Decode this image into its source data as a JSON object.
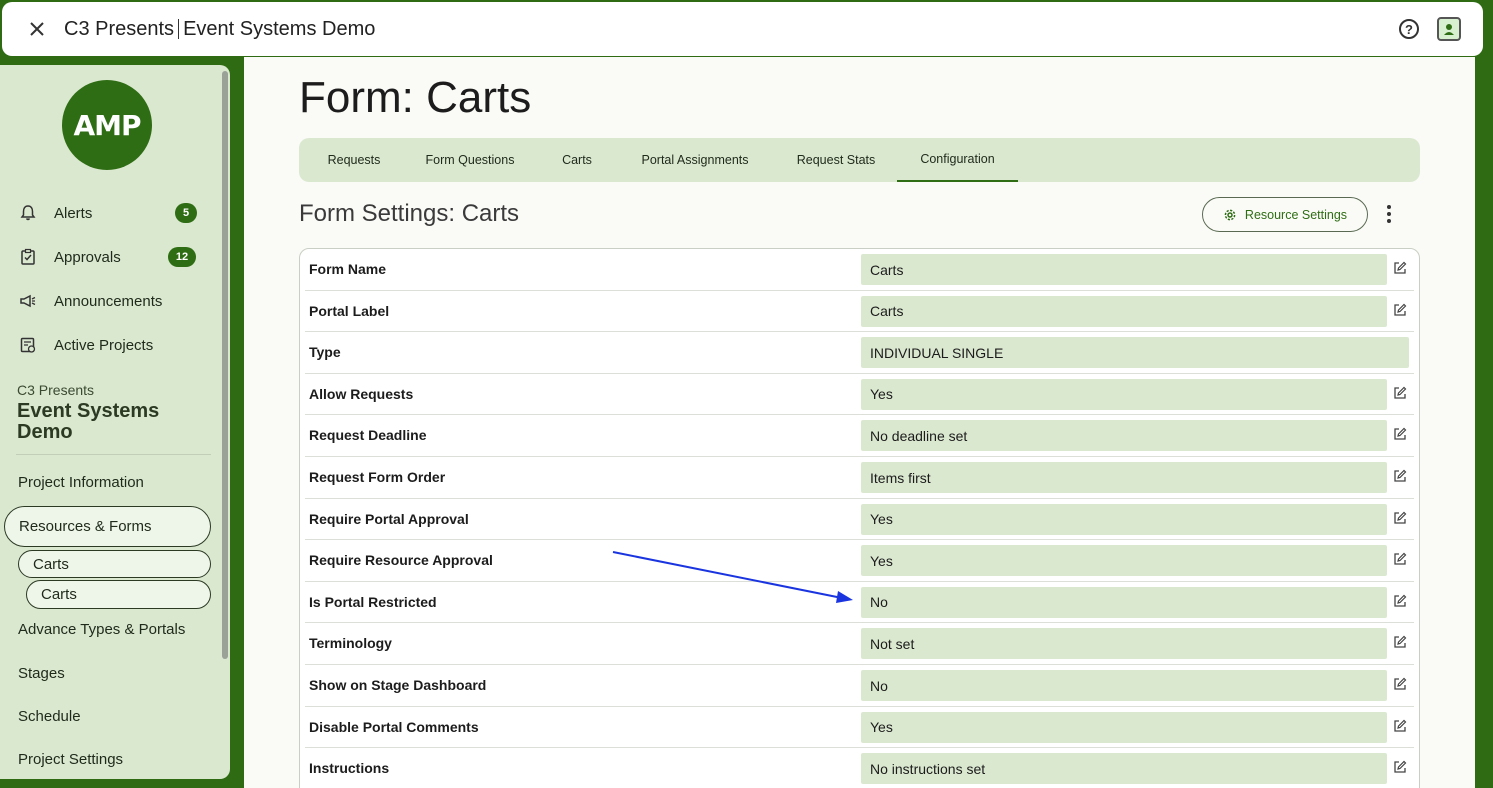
{
  "topbar": {
    "org": "C3 Presents",
    "project": "Event Systems Demo"
  },
  "sidebar": {
    "logo_text": "AMP",
    "nav": [
      {
        "label": "Alerts",
        "badge": "5",
        "icon": "bell-icon"
      },
      {
        "label": "Approvals",
        "badge": "12",
        "icon": "clipboard-check-icon"
      },
      {
        "label": "Announcements",
        "icon": "megaphone-icon"
      },
      {
        "label": "Active Projects",
        "icon": "project-list-icon"
      }
    ],
    "project_org": "C3 Presents",
    "project_name": "Event Systems Demo",
    "menu": {
      "project_information": "Project Information",
      "resources_forms": "Resources & Forms",
      "carts_1": "Carts",
      "carts_2": "Carts",
      "advance_types": "Advance Types & Portals",
      "stages": "Stages",
      "schedule": "Schedule",
      "project_settings": "Project Settings"
    }
  },
  "main": {
    "title": "Form: Carts",
    "tabs": [
      "Requests",
      "Form Questions",
      "Carts",
      "Portal Assignments",
      "Request Stats",
      "Configuration"
    ],
    "active_tab": "Configuration",
    "settings_title": "Form Settings: Carts",
    "resource_settings_label": "Resource Settings",
    "rows": [
      {
        "label": "Form Name",
        "value": "Carts",
        "editable": true
      },
      {
        "label": "Portal Label",
        "value": "Carts",
        "editable": true
      },
      {
        "label": "Type",
        "value": "INDIVIDUAL SINGLE",
        "editable": false
      },
      {
        "label": "Allow Requests",
        "value": "Yes",
        "editable": true
      },
      {
        "label": "Request Deadline",
        "value": "No deadline set",
        "editable": true
      },
      {
        "label": "Request Form Order",
        "value": "Items first",
        "editable": true
      },
      {
        "label": "Require Portal Approval",
        "value": "Yes",
        "editable": true
      },
      {
        "label": "Require Resource Approval",
        "value": "Yes",
        "editable": true
      },
      {
        "label": "Is Portal Restricted",
        "value": "No",
        "editable": true
      },
      {
        "label": "Terminology",
        "value": "Not set",
        "editable": true
      },
      {
        "label": "Show on Stage Dashboard",
        "value": "No",
        "editable": true
      },
      {
        "label": "Disable Portal Comments",
        "value": "Yes",
        "editable": true
      },
      {
        "label": "Instructions",
        "value": "No instructions set",
        "editable": true
      }
    ]
  },
  "colors": {
    "brand": "#2f6d14",
    "panel": "#dbe8d0",
    "annotation_arrow": "#1a35e0"
  }
}
